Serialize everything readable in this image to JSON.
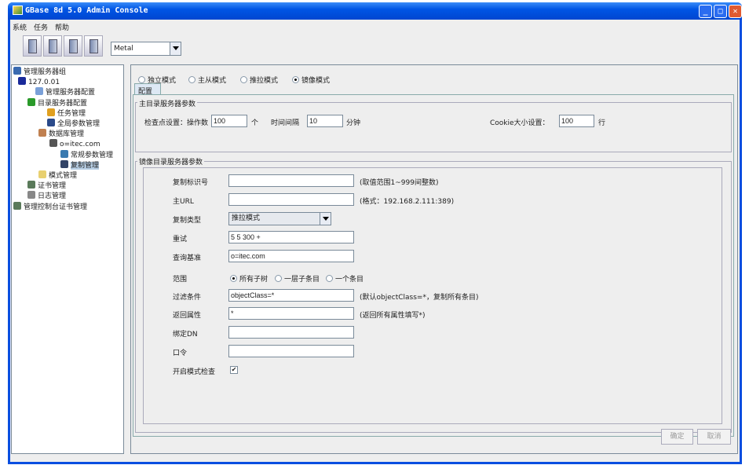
{
  "window": {
    "title": "GBase 8d 5.0 Admin Console",
    "minimize": "_",
    "maximize": "□",
    "close": "✕"
  },
  "menu": [
    "系统",
    "任务",
    "帮助"
  ],
  "toolbar": {
    "buttons": [
      "server-add-icon",
      "server-refresh-icon",
      "server-settings-icon",
      "server-help-icon"
    ],
    "theme": "Metal"
  },
  "tree": [
    {
      "label": "管理服务器组",
      "icon": "server-group-icon",
      "color": "#3a6ab0"
    },
    {
      "label": "127.0.01",
      "icon": "computer-icon",
      "color": "#1a2a9a"
    },
    {
      "label": "管理服务器配置",
      "icon": "user-icon",
      "color": "#7aa0d8"
    },
    {
      "label": "目录服务器配置",
      "icon": "tree-icon",
      "color": "#2a9a2a"
    },
    {
      "label": "任务管理",
      "icon": "tools-icon",
      "color": "#e0a020"
    },
    {
      "label": "全局参数管理",
      "icon": "globe-icon",
      "color": "#2a4a8a"
    },
    {
      "label": "数据库管理",
      "icon": "database-icon",
      "color": "#c08050"
    },
    {
      "label": "o=itec.com",
      "icon": "server-icon",
      "color": "#555555"
    },
    {
      "label": "常规参数管理",
      "icon": "home-icon",
      "color": "#3a7ab0"
    },
    {
      "label": "复制管理",
      "icon": "replication-icon",
      "color": "#334466"
    },
    {
      "label": "模式管理",
      "icon": "folder-icon",
      "color": "#e8d070"
    },
    {
      "label": "证书管理",
      "icon": "certificate-icon",
      "color": "#5a7a5a"
    },
    {
      "label": "日志管理",
      "icon": "log-icon",
      "color": "#888888"
    },
    {
      "label": "管理控制台证书管理",
      "icon": "certificate-icon",
      "color": "#5a7a5a"
    }
  ],
  "modes": [
    {
      "label": "独立模式",
      "checked": false
    },
    {
      "label": "主从模式",
      "checked": false
    },
    {
      "label": "推拉模式",
      "checked": false
    },
    {
      "label": "镜像模式",
      "checked": true
    }
  ],
  "tab": "配置",
  "master": {
    "legend": "主目录服务器参数",
    "checkpoint_label": "检查点设置：操作数",
    "checkpoint_value": "100",
    "checkpoint_unit": "个",
    "interval_label": "时间间隔",
    "interval_value": "10",
    "interval_unit": "分钟",
    "cookie_label": "Cookie大小设置：",
    "cookie_value": "100",
    "cookie_unit": "行"
  },
  "mirror": {
    "legend": "镜像目录服务器参数",
    "rows": [
      {
        "label": "复制标识号",
        "value": "",
        "hint": "(取值范围1~999间整数)"
      },
      {
        "label": "主URL",
        "value": "",
        "hint": "(格式：192.168.2.111:389)"
      },
      {
        "label": "复制类型",
        "value": "推拉模式",
        "hint": ""
      },
      {
        "label": "重试",
        "value": "5 5 300 +",
        "hint": ""
      },
      {
        "label": "查询基准",
        "value": "o=itec.com",
        "hint": ""
      },
      {
        "label": "范围",
        "value": "",
        "hint": ""
      },
      {
        "label": "过滤条件",
        "value": "objectClass=*",
        "hint": "(默认objectClass=*，复制所有条目)"
      },
      {
        "label": "返回属性",
        "value": "*",
        "hint": "(返回所有属性填写*)"
      },
      {
        "label": "绑定DN",
        "value": "",
        "hint": ""
      },
      {
        "label": "口令",
        "value": "",
        "hint": ""
      },
      {
        "label": "开启模式检查",
        "value": "",
        "hint": ""
      }
    ],
    "scope": [
      {
        "label": "所有子树",
        "checked": true
      },
      {
        "label": "一层子条目",
        "checked": false
      },
      {
        "label": "一个条目",
        "checked": false
      }
    ],
    "schema_check": true
  },
  "buttons": {
    "ok": "确定",
    "cancel": "取消"
  }
}
